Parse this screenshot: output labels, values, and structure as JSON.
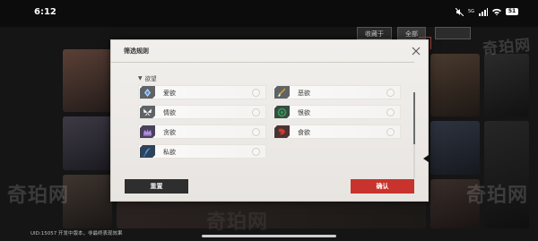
{
  "status_bar": {
    "time": "6:12",
    "network_label": "5G",
    "battery_level": "51"
  },
  "background": {
    "tabs": [
      "收藏于",
      "全部",
      ""
    ],
    "uid_text": "UID:15057  开发中版本，非最终表现效果"
  },
  "watermark": "奇珀网",
  "dialog": {
    "title": "筛选规则",
    "section_label": "欲望",
    "options": [
      {
        "label": "爱欲",
        "icon": "heart-gem-icon",
        "icon_color": "#b4d8ff"
      },
      {
        "label": "恶欲",
        "icon": "dagger-icon",
        "icon_color": "#e8a21f"
      },
      {
        "label": "情欲",
        "icon": "butterfly-icon",
        "icon_color": "#ffffff"
      },
      {
        "label": "恨欲",
        "icon": "swirl-icon",
        "icon_color": "#2e9e5b"
      },
      {
        "label": "贪欲",
        "icon": "crown-icon",
        "icon_color": "#b28de8"
      },
      {
        "label": "食欲",
        "icon": "fang-icon",
        "icon_color": "#d9362c"
      },
      {
        "label": "私欲",
        "icon": "feather-pen-icon",
        "icon_color": "#49a3ff"
      }
    ],
    "reset_label": "重置",
    "confirm_label": "确认",
    "colors": {
      "confirm_bg": "#c8342d",
      "reset_bg": "#2e2e2e",
      "panel_bg": "#f1efec"
    }
  }
}
